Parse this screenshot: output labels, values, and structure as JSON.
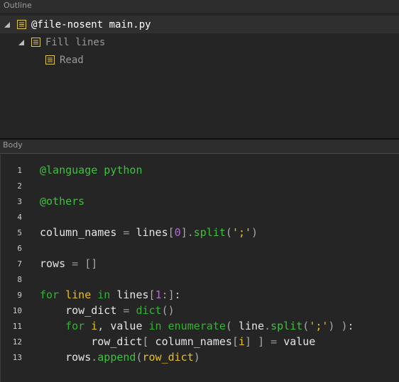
{
  "outline": {
    "header": "Outline",
    "nodes": [
      {
        "label": "@file-nosent main.py",
        "expanded": true,
        "selected": true
      },
      {
        "label": "Fill lines",
        "expanded": true,
        "selected": false
      },
      {
        "label": "Read",
        "expanded": false,
        "selected": false
      }
    ]
  },
  "body": {
    "header": "Body",
    "lines": [
      {
        "num": "1",
        "tokens": [
          {
            "t": "directive",
            "v": "@language python"
          }
        ]
      },
      {
        "num": "2",
        "tokens": []
      },
      {
        "num": "3",
        "tokens": [
          {
            "t": "directive",
            "v": "@others"
          }
        ]
      },
      {
        "num": "4",
        "tokens": []
      },
      {
        "num": "5",
        "tokens": [
          {
            "t": "ident",
            "v": "column_names"
          },
          {
            "t": "op",
            "v": " = "
          },
          {
            "t": "ident",
            "v": "lines"
          },
          {
            "t": "bracket",
            "v": "["
          },
          {
            "t": "number",
            "v": "0"
          },
          {
            "t": "bracket",
            "v": "]"
          },
          {
            "t": "op",
            "v": "."
          },
          {
            "t": "method",
            "v": "split"
          },
          {
            "t": "bracket",
            "v": "("
          },
          {
            "t": "string",
            "v": "';'"
          },
          {
            "t": "bracket",
            "v": ")"
          }
        ]
      },
      {
        "num": "6",
        "tokens": []
      },
      {
        "num": "7",
        "tokens": [
          {
            "t": "ident",
            "v": "rows"
          },
          {
            "t": "op",
            "v": " = "
          },
          {
            "t": "bracket",
            "v": "[]"
          }
        ]
      },
      {
        "num": "8",
        "tokens": []
      },
      {
        "num": "9",
        "tokens": [
          {
            "t": "keyword",
            "v": "for"
          },
          {
            "t": "ident",
            "v": " "
          },
          {
            "t": "string",
            "v": "line"
          },
          {
            "t": "ident",
            "v": " "
          },
          {
            "t": "keyword",
            "v": "in"
          },
          {
            "t": "ident",
            "v": " lines"
          },
          {
            "t": "bracket",
            "v": "["
          },
          {
            "t": "number",
            "v": "1"
          },
          {
            "t": "op",
            "v": ":"
          },
          {
            "t": "bracket",
            "v": "]"
          },
          {
            "t": "punct",
            "v": ":"
          }
        ]
      },
      {
        "num": "10",
        "tokens": [
          {
            "t": "ident",
            "v": "    row_dict"
          },
          {
            "t": "op",
            "v": " = "
          },
          {
            "t": "builtin",
            "v": "dict"
          },
          {
            "t": "bracket",
            "v": "()"
          }
        ]
      },
      {
        "num": "11",
        "tokens": [
          {
            "t": "ident",
            "v": "    "
          },
          {
            "t": "keyword",
            "v": "for"
          },
          {
            "t": "ident",
            "v": " "
          },
          {
            "t": "string",
            "v": "i"
          },
          {
            "t": "punct",
            "v": ", "
          },
          {
            "t": "ident",
            "v": "value "
          },
          {
            "t": "keyword",
            "v": "in"
          },
          {
            "t": "ident",
            "v": " "
          },
          {
            "t": "builtin",
            "v": "enumerate"
          },
          {
            "t": "bracket",
            "v": "("
          },
          {
            "t": "ident",
            "v": " line"
          },
          {
            "t": "op",
            "v": "."
          },
          {
            "t": "method",
            "v": "split"
          },
          {
            "t": "bracket",
            "v": "("
          },
          {
            "t": "string",
            "v": "';'"
          },
          {
            "t": "bracket",
            "v": ")"
          },
          {
            "t": "ident",
            "v": " "
          },
          {
            "t": "bracket",
            "v": ")"
          },
          {
            "t": "punct",
            "v": ":"
          }
        ]
      },
      {
        "num": "12",
        "tokens": [
          {
            "t": "ident",
            "v": "        row_dict"
          },
          {
            "t": "bracket",
            "v": "["
          },
          {
            "t": "ident",
            "v": " column_names"
          },
          {
            "t": "bracket",
            "v": "["
          },
          {
            "t": "string",
            "v": "i"
          },
          {
            "t": "bracket",
            "v": "]"
          },
          {
            "t": "ident",
            "v": " "
          },
          {
            "t": "bracket",
            "v": "]"
          },
          {
            "t": "op",
            "v": " = "
          },
          {
            "t": "ident",
            "v": "value"
          }
        ]
      },
      {
        "num": "13",
        "tokens": [
          {
            "t": "ident",
            "v": "    rows"
          },
          {
            "t": "op",
            "v": "."
          },
          {
            "t": "method",
            "v": "append"
          },
          {
            "t": "bracket",
            "v": "("
          },
          {
            "t": "string",
            "v": "row_dict"
          },
          {
            "t": "bracket",
            "v": ")"
          }
        ]
      }
    ]
  },
  "colors": {
    "background": "#252525",
    "header_bg": "#2d2d2d",
    "selection_bg": "#2f2f2f",
    "directive_green": "#3ec13e",
    "string_yellow": "#e6c020",
    "number_purple": "#b569d8",
    "node_icon_yellow": "#e2c84a"
  }
}
